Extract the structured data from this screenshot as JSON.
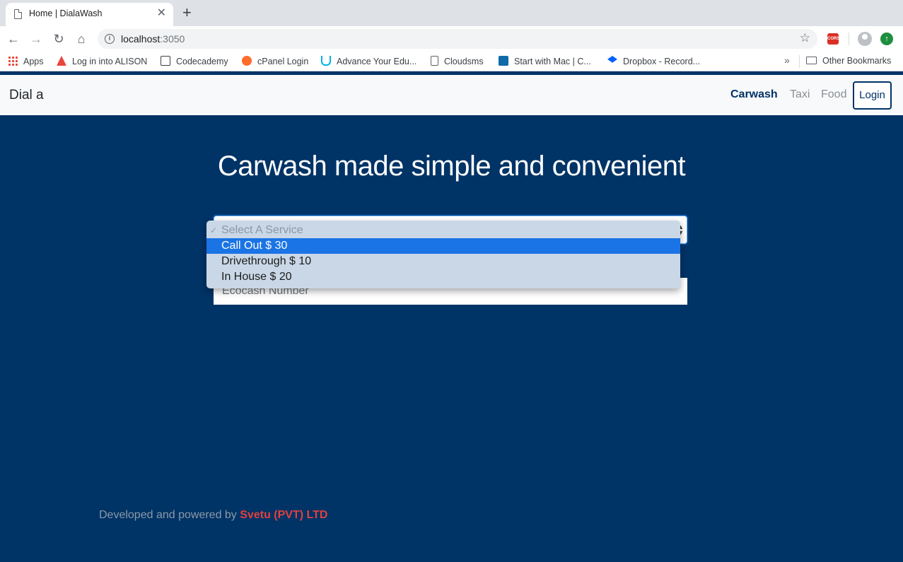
{
  "browser": {
    "tab_title": "Home | DialaWash",
    "new_tab": "+",
    "close_glyph": "✕",
    "url_host": "localhost",
    "url_port": ":3050",
    "ext_cors_label": "CORS",
    "bookmarks": [
      {
        "label": "Apps",
        "icon": "apps-grid-icon"
      },
      {
        "label": "Log in into ALISON",
        "icon": "alison-icon",
        "color": "#e8453c"
      },
      {
        "label": "Codecademy",
        "icon": "codecademy-icon",
        "color": "#3c4043"
      },
      {
        "label": "cPanel Login",
        "icon": "cpanel-icon",
        "color": "#ff6c2c"
      },
      {
        "label": "Advance Your Edu...",
        "icon": "udacity-icon",
        "color": "#02b3e4"
      },
      {
        "label": "Cloudsms",
        "icon": "page-icon",
        "color": "#5f6368"
      },
      {
        "label": "Start with Mac | C...",
        "icon": "mac-icon",
        "color": "#0e6aa8"
      },
      {
        "label": "Dropbox - Record...",
        "icon": "dropbox-icon",
        "color": "#0061fe"
      }
    ],
    "more_bookmarks": "»",
    "other_bookmarks": "Other Bookmarks"
  },
  "navbar": {
    "brand": "Dial a",
    "links": [
      {
        "label": "Carwash",
        "active": true
      },
      {
        "label": "Taxi",
        "active": false
      },
      {
        "label": "Food",
        "active": false
      }
    ],
    "login_label": "Login"
  },
  "hero": {
    "title": "Carwash made simple and convenient"
  },
  "form": {
    "service_select": {
      "options": [
        {
          "label": "Select A Service",
          "disabled": true,
          "checked": true
        },
        {
          "label": "Call Out $ 30",
          "highlighted": true
        },
        {
          "label": "Drivethrough $ 10"
        },
        {
          "label": "In House $ 20"
        }
      ]
    },
    "ecocash_placeholder": "Ecocash Number"
  },
  "footer": {
    "text": "Developed and powered by",
    "company": "Svetu (PVT) LTD"
  },
  "colors": {
    "page_background": "#003366",
    "accent": "#003366",
    "company_highlight": "#e0413f",
    "dropdown_highlight": "#1a74e5"
  }
}
